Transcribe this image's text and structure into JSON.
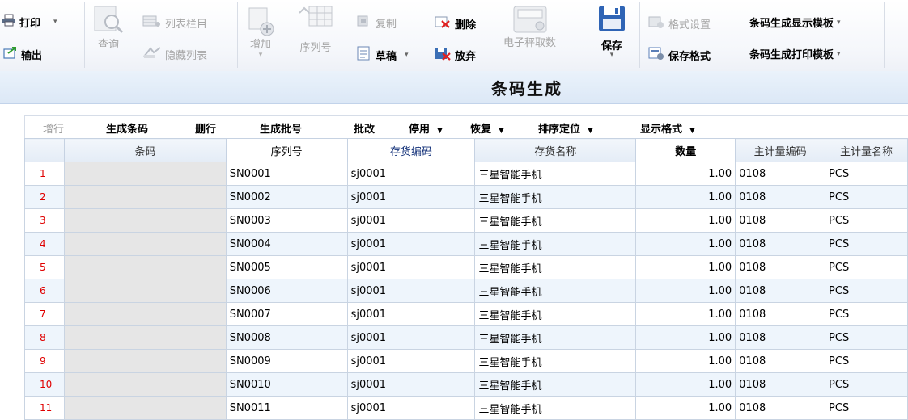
{
  "toolbar": {
    "print": "打印",
    "export": "输出",
    "query": "查询",
    "list_columns": "列表栏目",
    "hide_list": "隐藏列表",
    "add": "增加",
    "serial_no": "序列号",
    "copy": "复制",
    "delete": "删除",
    "draft": "草稿",
    "discard": "放弃",
    "e_scale": "电子秤取数",
    "save": "保存",
    "format_settings": "格式设置",
    "save_format": "保存格式",
    "display_template": "条码生成显示模板",
    "print_template": "条码生成打印模板"
  },
  "page_title": "条码生成",
  "grid_toolbar": {
    "add_row": "增行",
    "gen_barcode": "生成条码",
    "delete_row": "删行",
    "gen_batch": "生成批号",
    "batch_edit": "批改",
    "disable": "停用",
    "restore": "恢复",
    "sort_locate": "排序定位",
    "display_format": "显示格式"
  },
  "columns": [
    "条码",
    "序列号",
    "存货编码",
    "存货名称",
    "数量",
    "主计量编码",
    "主计量名称"
  ],
  "rows": [
    {
      "n": "1",
      "barcode": "",
      "serial": "SN0001",
      "code": "sj0001",
      "name": "三星智能手机",
      "qty": "1.00",
      "unit_code": "0108",
      "unit_name": "PCS"
    },
    {
      "n": "2",
      "barcode": "",
      "serial": "SN0002",
      "code": "sj0001",
      "name": "三星智能手机",
      "qty": "1.00",
      "unit_code": "0108",
      "unit_name": "PCS"
    },
    {
      "n": "3",
      "barcode": "",
      "serial": "SN0003",
      "code": "sj0001",
      "name": "三星智能手机",
      "qty": "1.00",
      "unit_code": "0108",
      "unit_name": "PCS"
    },
    {
      "n": "4",
      "barcode": "",
      "serial": "SN0004",
      "code": "sj0001",
      "name": "三星智能手机",
      "qty": "1.00",
      "unit_code": "0108",
      "unit_name": "PCS"
    },
    {
      "n": "5",
      "barcode": "",
      "serial": "SN0005",
      "code": "sj0001",
      "name": "三星智能手机",
      "qty": "1.00",
      "unit_code": "0108",
      "unit_name": "PCS"
    },
    {
      "n": "6",
      "barcode": "",
      "serial": "SN0006",
      "code": "sj0001",
      "name": "三星智能手机",
      "qty": "1.00",
      "unit_code": "0108",
      "unit_name": "PCS"
    },
    {
      "n": "7",
      "barcode": "",
      "serial": "SN0007",
      "code": "sj0001",
      "name": "三星智能手机",
      "qty": "1.00",
      "unit_code": "0108",
      "unit_name": "PCS"
    },
    {
      "n": "8",
      "barcode": "",
      "serial": "SN0008",
      "code": "sj0001",
      "name": "三星智能手机",
      "qty": "1.00",
      "unit_code": "0108",
      "unit_name": "PCS"
    },
    {
      "n": "9",
      "barcode": "",
      "serial": "SN0009",
      "code": "sj0001",
      "name": "三星智能手机",
      "qty": "1.00",
      "unit_code": "0108",
      "unit_name": "PCS"
    },
    {
      "n": "10",
      "barcode": "",
      "serial": "SN0010",
      "code": "sj0001",
      "name": "三星智能手机",
      "qty": "1.00",
      "unit_code": "0108",
      "unit_name": "PCS"
    },
    {
      "n": "11",
      "barcode": "",
      "serial": "SN0011",
      "code": "sj0001",
      "name": "三星智能手机",
      "qty": "1.00",
      "unit_code": "0108",
      "unit_name": "PCS"
    }
  ]
}
